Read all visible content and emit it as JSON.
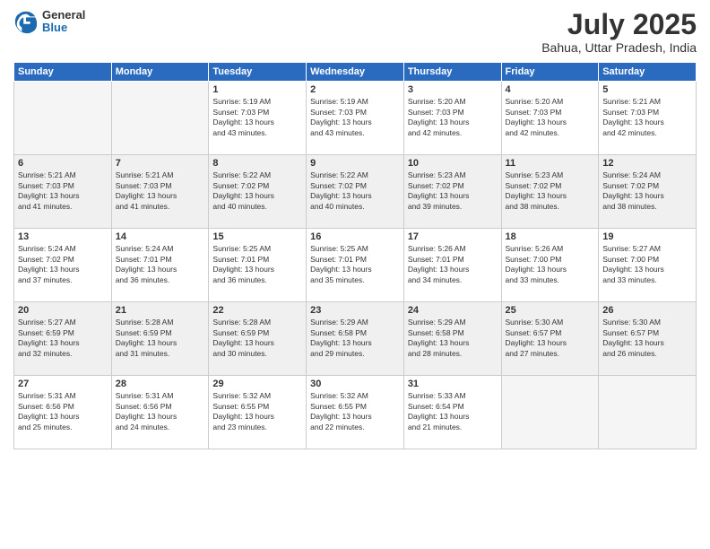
{
  "header": {
    "logo_general": "General",
    "logo_blue": "Blue",
    "title": "July 2025",
    "location": "Bahua, Uttar Pradesh, India"
  },
  "weekdays": [
    "Sunday",
    "Monday",
    "Tuesday",
    "Wednesday",
    "Thursday",
    "Friday",
    "Saturday"
  ],
  "weeks": [
    {
      "days": [
        {
          "num": "",
          "info": "",
          "empty": true
        },
        {
          "num": "",
          "info": "",
          "empty": true
        },
        {
          "num": "1",
          "info": "Sunrise: 5:19 AM\nSunset: 7:03 PM\nDaylight: 13 hours\nand 43 minutes."
        },
        {
          "num": "2",
          "info": "Sunrise: 5:19 AM\nSunset: 7:03 PM\nDaylight: 13 hours\nand 43 minutes."
        },
        {
          "num": "3",
          "info": "Sunrise: 5:20 AM\nSunset: 7:03 PM\nDaylight: 13 hours\nand 42 minutes."
        },
        {
          "num": "4",
          "info": "Sunrise: 5:20 AM\nSunset: 7:03 PM\nDaylight: 13 hours\nand 42 minutes."
        },
        {
          "num": "5",
          "info": "Sunrise: 5:21 AM\nSunset: 7:03 PM\nDaylight: 13 hours\nand 42 minutes."
        }
      ]
    },
    {
      "days": [
        {
          "num": "6",
          "info": "Sunrise: 5:21 AM\nSunset: 7:03 PM\nDaylight: 13 hours\nand 41 minutes."
        },
        {
          "num": "7",
          "info": "Sunrise: 5:21 AM\nSunset: 7:03 PM\nDaylight: 13 hours\nand 41 minutes."
        },
        {
          "num": "8",
          "info": "Sunrise: 5:22 AM\nSunset: 7:02 PM\nDaylight: 13 hours\nand 40 minutes."
        },
        {
          "num": "9",
          "info": "Sunrise: 5:22 AM\nSunset: 7:02 PM\nDaylight: 13 hours\nand 40 minutes."
        },
        {
          "num": "10",
          "info": "Sunrise: 5:23 AM\nSunset: 7:02 PM\nDaylight: 13 hours\nand 39 minutes."
        },
        {
          "num": "11",
          "info": "Sunrise: 5:23 AM\nSunset: 7:02 PM\nDaylight: 13 hours\nand 38 minutes."
        },
        {
          "num": "12",
          "info": "Sunrise: 5:24 AM\nSunset: 7:02 PM\nDaylight: 13 hours\nand 38 minutes."
        }
      ]
    },
    {
      "days": [
        {
          "num": "13",
          "info": "Sunrise: 5:24 AM\nSunset: 7:02 PM\nDaylight: 13 hours\nand 37 minutes."
        },
        {
          "num": "14",
          "info": "Sunrise: 5:24 AM\nSunset: 7:01 PM\nDaylight: 13 hours\nand 36 minutes."
        },
        {
          "num": "15",
          "info": "Sunrise: 5:25 AM\nSunset: 7:01 PM\nDaylight: 13 hours\nand 36 minutes."
        },
        {
          "num": "16",
          "info": "Sunrise: 5:25 AM\nSunset: 7:01 PM\nDaylight: 13 hours\nand 35 minutes."
        },
        {
          "num": "17",
          "info": "Sunrise: 5:26 AM\nSunset: 7:01 PM\nDaylight: 13 hours\nand 34 minutes."
        },
        {
          "num": "18",
          "info": "Sunrise: 5:26 AM\nSunset: 7:00 PM\nDaylight: 13 hours\nand 33 minutes."
        },
        {
          "num": "19",
          "info": "Sunrise: 5:27 AM\nSunset: 7:00 PM\nDaylight: 13 hours\nand 33 minutes."
        }
      ]
    },
    {
      "days": [
        {
          "num": "20",
          "info": "Sunrise: 5:27 AM\nSunset: 6:59 PM\nDaylight: 13 hours\nand 32 minutes."
        },
        {
          "num": "21",
          "info": "Sunrise: 5:28 AM\nSunset: 6:59 PM\nDaylight: 13 hours\nand 31 minutes."
        },
        {
          "num": "22",
          "info": "Sunrise: 5:28 AM\nSunset: 6:59 PM\nDaylight: 13 hours\nand 30 minutes."
        },
        {
          "num": "23",
          "info": "Sunrise: 5:29 AM\nSunset: 6:58 PM\nDaylight: 13 hours\nand 29 minutes."
        },
        {
          "num": "24",
          "info": "Sunrise: 5:29 AM\nSunset: 6:58 PM\nDaylight: 13 hours\nand 28 minutes."
        },
        {
          "num": "25",
          "info": "Sunrise: 5:30 AM\nSunset: 6:57 PM\nDaylight: 13 hours\nand 27 minutes."
        },
        {
          "num": "26",
          "info": "Sunrise: 5:30 AM\nSunset: 6:57 PM\nDaylight: 13 hours\nand 26 minutes."
        }
      ]
    },
    {
      "days": [
        {
          "num": "27",
          "info": "Sunrise: 5:31 AM\nSunset: 6:56 PM\nDaylight: 13 hours\nand 25 minutes."
        },
        {
          "num": "28",
          "info": "Sunrise: 5:31 AM\nSunset: 6:56 PM\nDaylight: 13 hours\nand 24 minutes."
        },
        {
          "num": "29",
          "info": "Sunrise: 5:32 AM\nSunset: 6:55 PM\nDaylight: 13 hours\nand 23 minutes."
        },
        {
          "num": "30",
          "info": "Sunrise: 5:32 AM\nSunset: 6:55 PM\nDaylight: 13 hours\nand 22 minutes."
        },
        {
          "num": "31",
          "info": "Sunrise: 5:33 AM\nSunset: 6:54 PM\nDaylight: 13 hours\nand 21 minutes."
        },
        {
          "num": "",
          "info": "",
          "empty": true
        },
        {
          "num": "",
          "info": "",
          "empty": true
        }
      ]
    }
  ]
}
